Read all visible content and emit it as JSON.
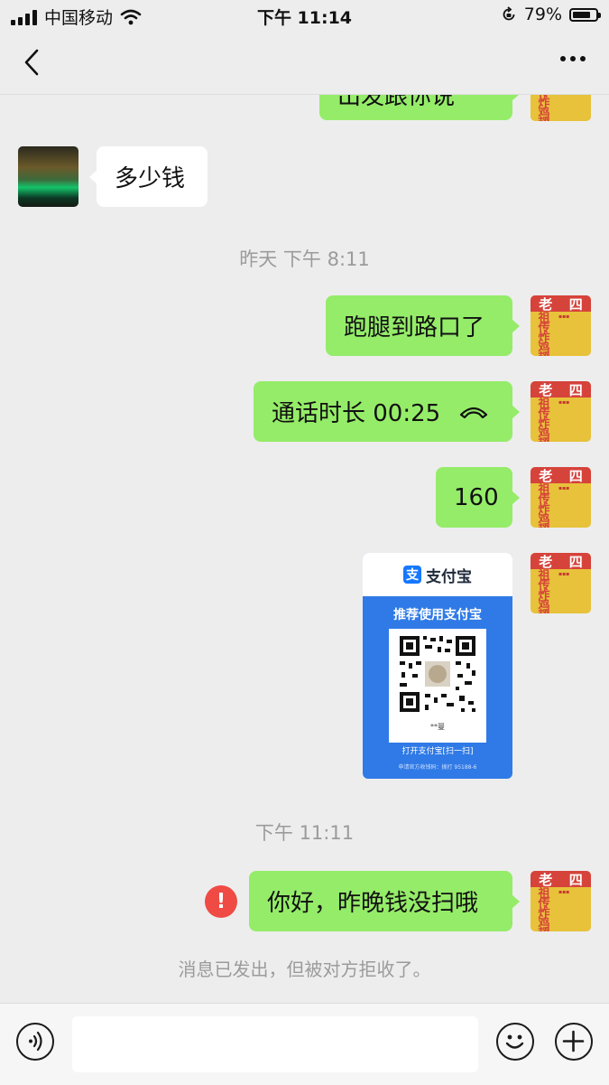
{
  "status_bar": {
    "carrier": "中国移动",
    "time": "下午 11:14",
    "battery": "79%"
  },
  "nav": {
    "back_icon": "chevron-left-icon",
    "more_icon": "more-dots-icon"
  },
  "messages": {
    "partial_top": "出发跟你说",
    "incoming_1": "多少钱",
    "timestamp_1": "昨天 下午 8:11",
    "outgoing_1": "跑腿到路口了",
    "call_record": "通话时长 00:25",
    "outgoing_amount": "160",
    "timestamp_2": "下午 11:11",
    "outgoing_failed": "你好，昨晚钱没扫哦",
    "rejected_notice": "消息已发出，但被对方拒收了。"
  },
  "avatar_text": {
    "band": [
      "老",
      "四"
    ],
    "big": [
      "祖",
      "传",
      "炸",
      "鸡",
      "翅"
    ]
  },
  "qr_card": {
    "brand": "支付宝",
    "brand_logo_char": "支",
    "title": "推荐使用支付宝",
    "payee": "**曼",
    "scan_hint": "打开支付宝[扫一扫]",
    "footer": "申请官方收钱码：拨打 95188-6"
  },
  "input_bar": {
    "placeholder": "",
    "left_icon": "voice-icon",
    "emoji_icon": "emoji-icon",
    "plus_icon": "plus-icon"
  },
  "colors": {
    "bubble_out": "#95ec69",
    "bubble_in": "#ffffff",
    "bg": "#ededed",
    "error": "#f04a45"
  }
}
